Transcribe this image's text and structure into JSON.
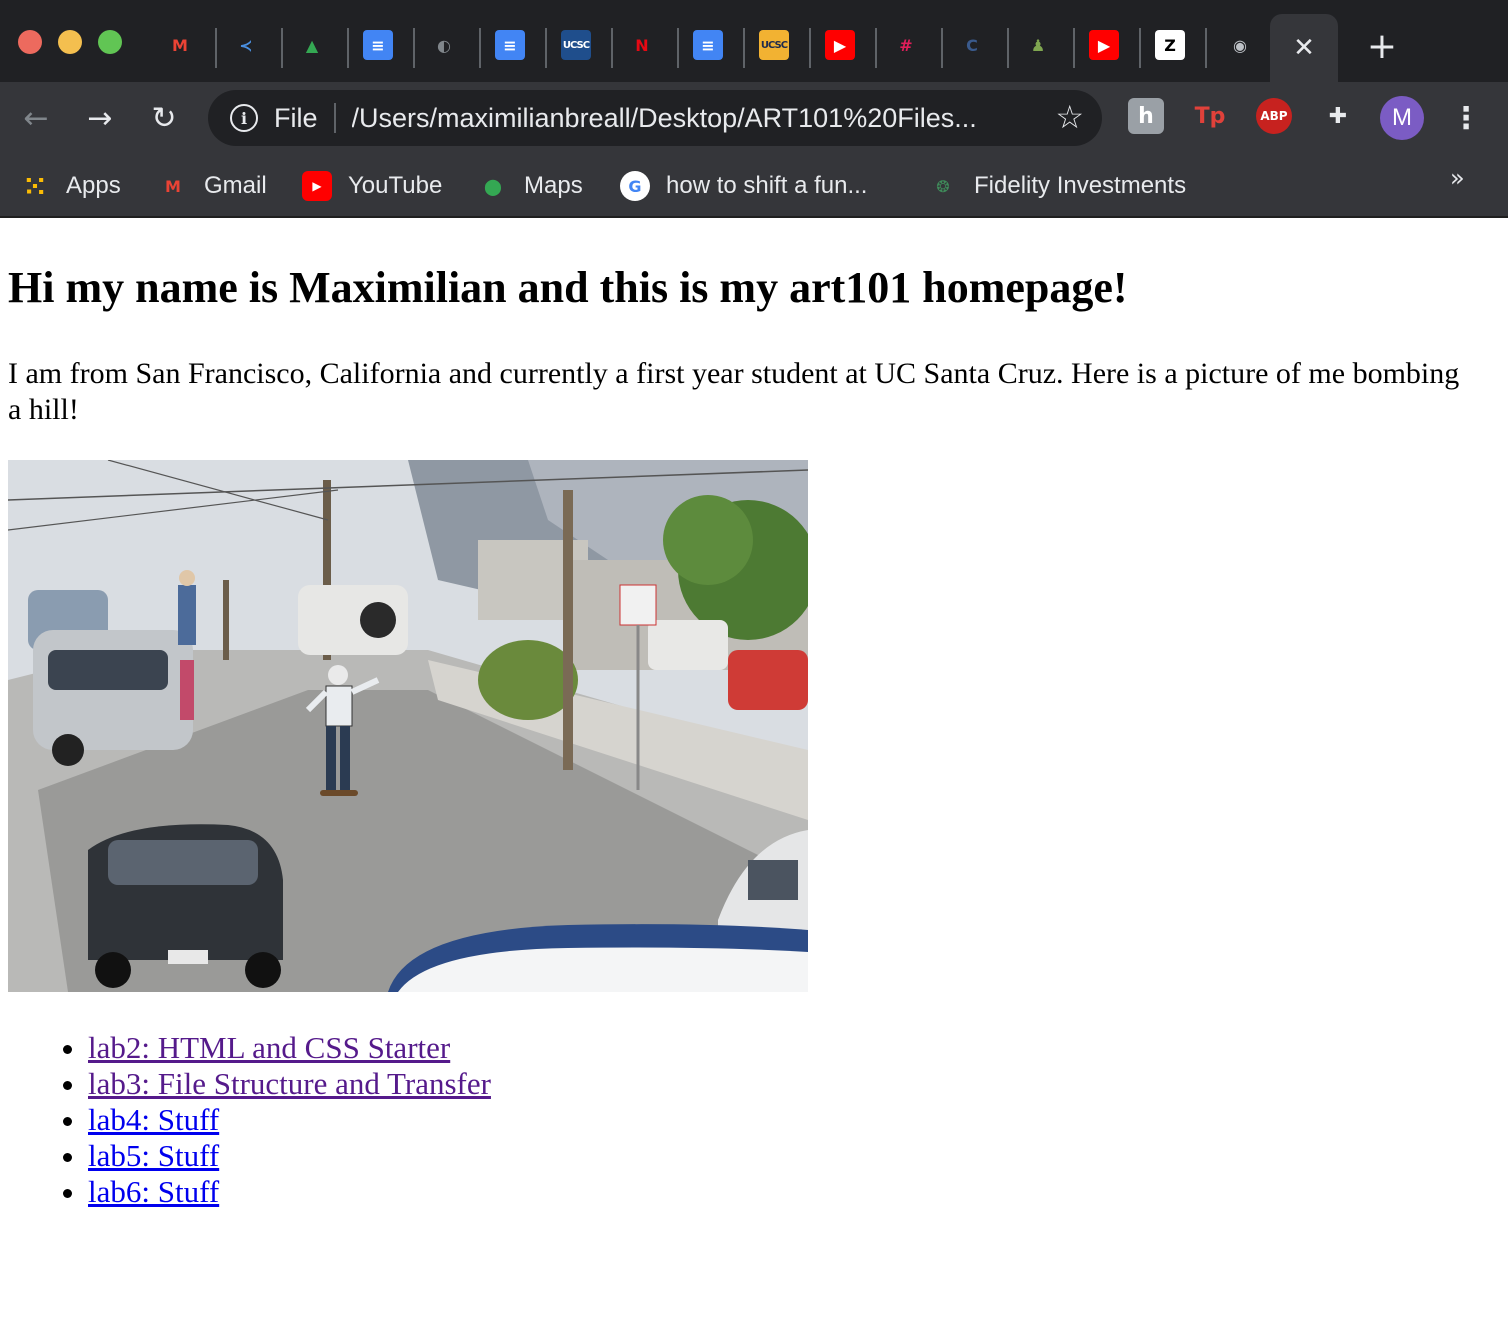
{
  "tabs": {
    "favicons": [
      {
        "name": "gmail-icon",
        "glyph": "M",
        "bg": "transparent",
        "fg": "#ea4335"
      },
      {
        "name": "share-nodes-icon",
        "glyph": "≺",
        "bg": "transparent",
        "fg": "#4a90e2"
      },
      {
        "name": "google-drive-icon",
        "glyph": "▲",
        "bg": "transparent",
        "fg": "#34a853"
      },
      {
        "name": "google-docs-icon",
        "glyph": "≡",
        "bg": "#4285f4",
        "fg": "#ffffff"
      },
      {
        "name": "globe-icon",
        "glyph": "◐",
        "bg": "transparent",
        "fg": "#80868b"
      },
      {
        "name": "google-docs-icon",
        "glyph": "≡",
        "bg": "#4285f4",
        "fg": "#ffffff"
      },
      {
        "name": "ucsc-icon",
        "glyph": "UCSC",
        "bg": "#1f4e8c",
        "fg": "#ffffff"
      },
      {
        "name": "netflix-icon",
        "glyph": "N",
        "bg": "transparent",
        "fg": "#e50914"
      },
      {
        "name": "google-docs-icon",
        "glyph": "≡",
        "bg": "#4285f4",
        "fg": "#ffffff"
      },
      {
        "name": "ucsc-gold-icon",
        "glyph": "UCSC",
        "bg": "#f2b232",
        "fg": "#1f2b4d"
      },
      {
        "name": "youtube-icon",
        "glyph": "▶",
        "bg": "#ff0000",
        "fg": "#ffffff"
      },
      {
        "name": "slack-icon",
        "glyph": "#",
        "bg": "transparent",
        "fg": "#e01e5a"
      },
      {
        "name": "canvas-c-icon",
        "glyph": "C",
        "bg": "transparent",
        "fg": "#3a5a8c"
      },
      {
        "name": "chess-pawn-icon",
        "glyph": "♟",
        "bg": "transparent",
        "fg": "#7fa650"
      },
      {
        "name": "youtube-icon",
        "glyph": "▶",
        "bg": "#ff0000",
        "fg": "#ffffff"
      },
      {
        "name": "zoom-z-icon",
        "glyph": "Z",
        "bg": "#ffffff",
        "fg": "#000000"
      },
      {
        "name": "record-circle-icon",
        "glyph": "◉",
        "bg": "transparent",
        "fg": "#bdc1c6"
      }
    ],
    "active_close_glyph": "✕",
    "new_tab_glyph": "+"
  },
  "toolbar": {
    "back_glyph": "←",
    "forward_glyph": "→",
    "reload_glyph": "↻",
    "info_glyph": "i",
    "scheme": "File",
    "url": "/Users/maximilianbreall/Desktop/ART101%20Files...",
    "star_glyph": "☆",
    "extensions": [
      {
        "name": "honey-extension-icon",
        "glyph": "h",
        "bg": "#9aa0a6",
        "fg": "#ffffff"
      },
      {
        "name": "tp-extension-icon",
        "glyph": "Tp",
        "bg": "transparent",
        "fg": "#e0413a"
      },
      {
        "name": "adblock-plus-icon",
        "glyph": "ABP",
        "bg": "#c7221f",
        "fg": "#ffffff"
      },
      {
        "name": "puzzle-extensions-icon",
        "glyph": "✚",
        "bg": "transparent",
        "fg": "#e8eaed"
      }
    ],
    "avatar_letter": "M",
    "menu_glyph": "⋮"
  },
  "bookmarks": [
    {
      "name": "bookmark-apps",
      "icon": "apps-grid-icon",
      "glyph": "⁙",
      "fg": "#fbbc05",
      "label": "Apps"
    },
    {
      "name": "bookmark-gmail",
      "icon": "gmail-icon",
      "glyph": "M",
      "fg": "#ea4335",
      "label": "Gmail"
    },
    {
      "name": "bookmark-youtube",
      "icon": "youtube-icon",
      "glyph": "▶",
      "fg": "#ff0000",
      "label": "YouTube"
    },
    {
      "name": "bookmark-maps",
      "icon": "maps-pin-icon",
      "glyph": "⬤",
      "fg": "#34a853",
      "label": "Maps"
    },
    {
      "name": "bookmark-google-search",
      "icon": "google-g-icon",
      "glyph": "G",
      "fg": "#4285f4",
      "label": "how to shift a fun..."
    },
    {
      "name": "bookmark-fidelity",
      "icon": "fidelity-icon",
      "glyph": "❂",
      "fg": "#3f8b5a",
      "label": "Fidelity Investments"
    }
  ],
  "bookmarks_overflow": "»",
  "page": {
    "heading": "Hi my name is Maximilian and this is my art101 homepage!",
    "intro": "I am from San Francisco, California and currently a first year student at UC Santa Cruz. Here is a picture of me bombing a hill!",
    "links": [
      {
        "label": "lab2: HTML and CSS Starter",
        "visited": true
      },
      {
        "label": "lab3: File Structure and Transfer",
        "visited": true
      },
      {
        "label": "lab4: Stuff",
        "visited": false
      },
      {
        "label": "lab5: Stuff",
        "visited": false
      },
      {
        "label": "lab6: Stuff",
        "visited": false
      }
    ]
  }
}
